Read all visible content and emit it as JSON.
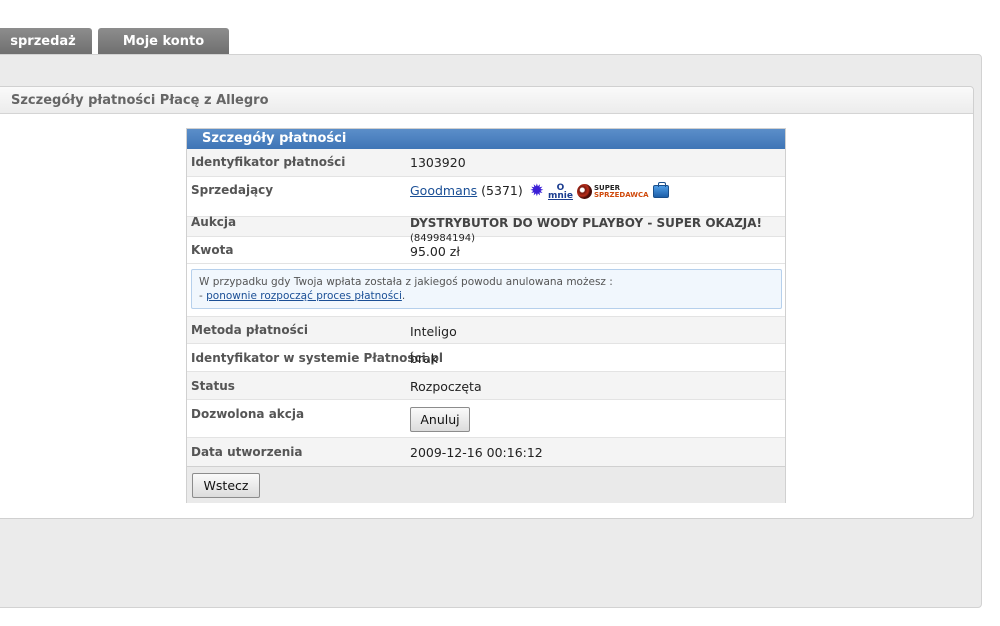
{
  "tabs": [
    {
      "label": "sprzedaż"
    },
    {
      "label": "Moje konto"
    }
  ],
  "panel": {
    "title": "Szczegóły płatności Płacę z Allegro"
  },
  "details": {
    "header": "Szczegóły płatności",
    "rows": {
      "id": {
        "label": "Identyfikator płatności",
        "value": "1303920"
      },
      "seller": {
        "label": "Sprzedający",
        "name": "Goodmans",
        "rating": "(5371)",
        "badges": {
          "omnie_top": "O",
          "omnie_bottom": "mnie",
          "super_top": "SUPER",
          "super_bottom": "SPRZEDAWCA"
        }
      },
      "auction": {
        "label": "Aukcja",
        "title": "DYSTRYBUTOR DO WODY PLAYBOY - SUPER OKAZJA!",
        "number": "(849984194)"
      },
      "amount": {
        "label": "Kwota",
        "value": "95.00 zł"
      },
      "notice": {
        "text": "W przypadku gdy Twoja wpłata została z jakiegoś powodu anulowana możesz :",
        "dash": "- ",
        "link": "ponownie rozpocząć proces płatności",
        "suffix": "."
      },
      "method": {
        "label": "Metoda płatności",
        "value": "Inteligo"
      },
      "system_id": {
        "label": "Identyfikator w systemie Płatności.pl",
        "value": "brak"
      },
      "status": {
        "label": "Status",
        "value": "Rozpoczęta"
      },
      "action": {
        "label": "Dozwolona akcja",
        "button": "Anuluj"
      },
      "created": {
        "label": "Data utworzenia",
        "value": "2009-12-16 00:16:12"
      }
    },
    "back_button": "Wstecz"
  }
}
